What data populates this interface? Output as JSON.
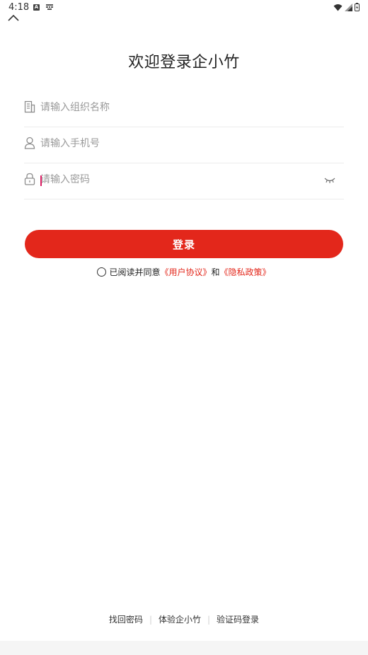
{
  "status_bar": {
    "time": "4:18",
    "app_badge": "A"
  },
  "page": {
    "title": "欢迎登录企小竹"
  },
  "form": {
    "org_placeholder": "请输入组织名称",
    "phone_placeholder": "请输入手机号",
    "password_placeholder": "请输入密码",
    "login_label": "登录"
  },
  "agreement": {
    "prefix": "已阅读并同意",
    "user_agreement": "《用户协议》",
    "and": "和",
    "privacy_policy": "《隐私政策》"
  },
  "footer": {
    "find_password": "找回密码",
    "sep1": "|",
    "try_app": "体验企小竹",
    "sep2": "|",
    "sms_login": "验证码登录"
  },
  "colors": {
    "accent": "#e3271b",
    "caret": "#d81b60"
  },
  "icons": [
    "chevron-up-icon",
    "building-icon",
    "user-icon",
    "lock-icon",
    "eye-closed-icon",
    "wifi-icon",
    "signal-icon",
    "battery-icon"
  ]
}
